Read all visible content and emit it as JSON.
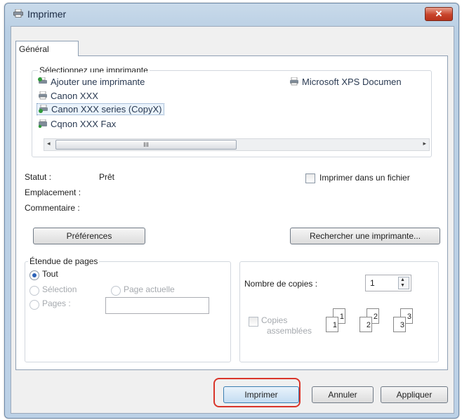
{
  "window": {
    "title": "Imprimer",
    "close_glyph": "✕"
  },
  "tabs": [
    {
      "label": "Général"
    }
  ],
  "printer_section": {
    "label": "Sélectionnez une imprimante",
    "printers": [
      {
        "label": "Ajouter une imprimante",
        "icon": "add-printer-icon"
      },
      {
        "label": "Microsoft XPS Documen",
        "icon": "printer-icon"
      },
      {
        "label": "Canon XXX",
        "icon": "printer-icon"
      },
      {
        "label": "Canon XXX series (CopyX)",
        "icon": "printer-icon",
        "selected": true
      },
      {
        "label": "Cqnon XXX Fax",
        "icon": "fax-icon"
      }
    ],
    "scroll_left": "◂",
    "scroll_thumb": "III",
    "scroll_right": "▸"
  },
  "status": {
    "status_label": "Statut :",
    "status_value": "Prêt",
    "location_label": "Emplacement :",
    "comment_label": "Commentaire :"
  },
  "print_to_file": {
    "label": "Imprimer dans un fichier",
    "checked": false
  },
  "buttons": {
    "preferences": "Préférences",
    "find_printer": "Rechercher une imprimante...",
    "print": "Imprimer",
    "cancel": "Annuler",
    "apply": "Appliquer"
  },
  "page_range": {
    "label": "Étendue de pages",
    "all": "Tout",
    "selection": "Sélection",
    "current_page": "Page actuelle",
    "pages": "Pages :",
    "pages_value": ""
  },
  "copies": {
    "label": "Nombre de copies :",
    "value": "1",
    "collate_line1": "Copies",
    "collate_line2": "assemblées",
    "collate_pages": [
      "1",
      "1",
      "2",
      "2",
      "3",
      "3"
    ]
  },
  "colors": {
    "accent": "#2c62b8",
    "highlight": "#d9352a"
  }
}
